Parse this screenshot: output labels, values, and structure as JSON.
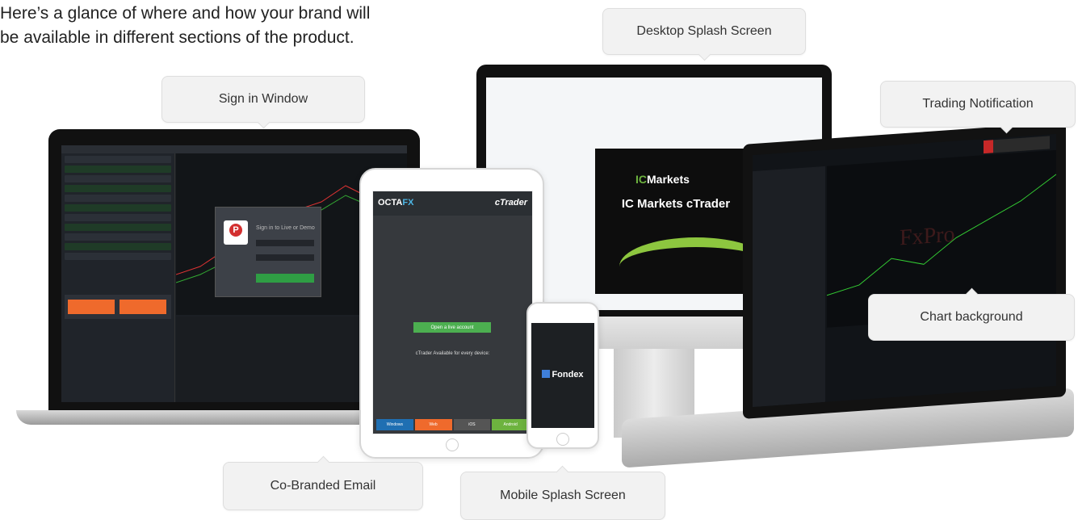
{
  "intro": {
    "line1": "Here’s a glance of where and how your brand will",
    "line2": "be available in different sections of the product."
  },
  "callouts": {
    "desktop_splash": "Desktop Splash Screen",
    "sign_in": "Sign in Window",
    "trading_notification": "Trading Notification",
    "chart_background": "Chart background",
    "co_branded_email": "Co-Branded Email",
    "mobile_splash": "Mobile Splash Screen"
  },
  "signin_window": {
    "title": "Sign in to Live or Demo",
    "logo_letter": "P"
  },
  "splash": {
    "logo_text": "IC",
    "logo_suffix": "Markets",
    "title": "IC Markets cTrader"
  },
  "email": {
    "brand_left": "OCTA",
    "brand_left_accent": "FX",
    "brand_right": "cTrader",
    "cta": "Open a live account",
    "tagline": "cTrader Available for every device:",
    "stores": [
      "Windows",
      "Web",
      "iOS",
      "Android"
    ]
  },
  "mobile": {
    "brand": "Fondex"
  },
  "chart": {
    "watermark": "FxPro"
  },
  "colors": {
    "sell": "#ef6a2c",
    "buy_green": "#4caf50",
    "splash_green": "#8dc63f",
    "store_colors": [
      "#1f6fb2",
      "#ef6a2c",
      "#555555",
      "#6db33f"
    ]
  }
}
